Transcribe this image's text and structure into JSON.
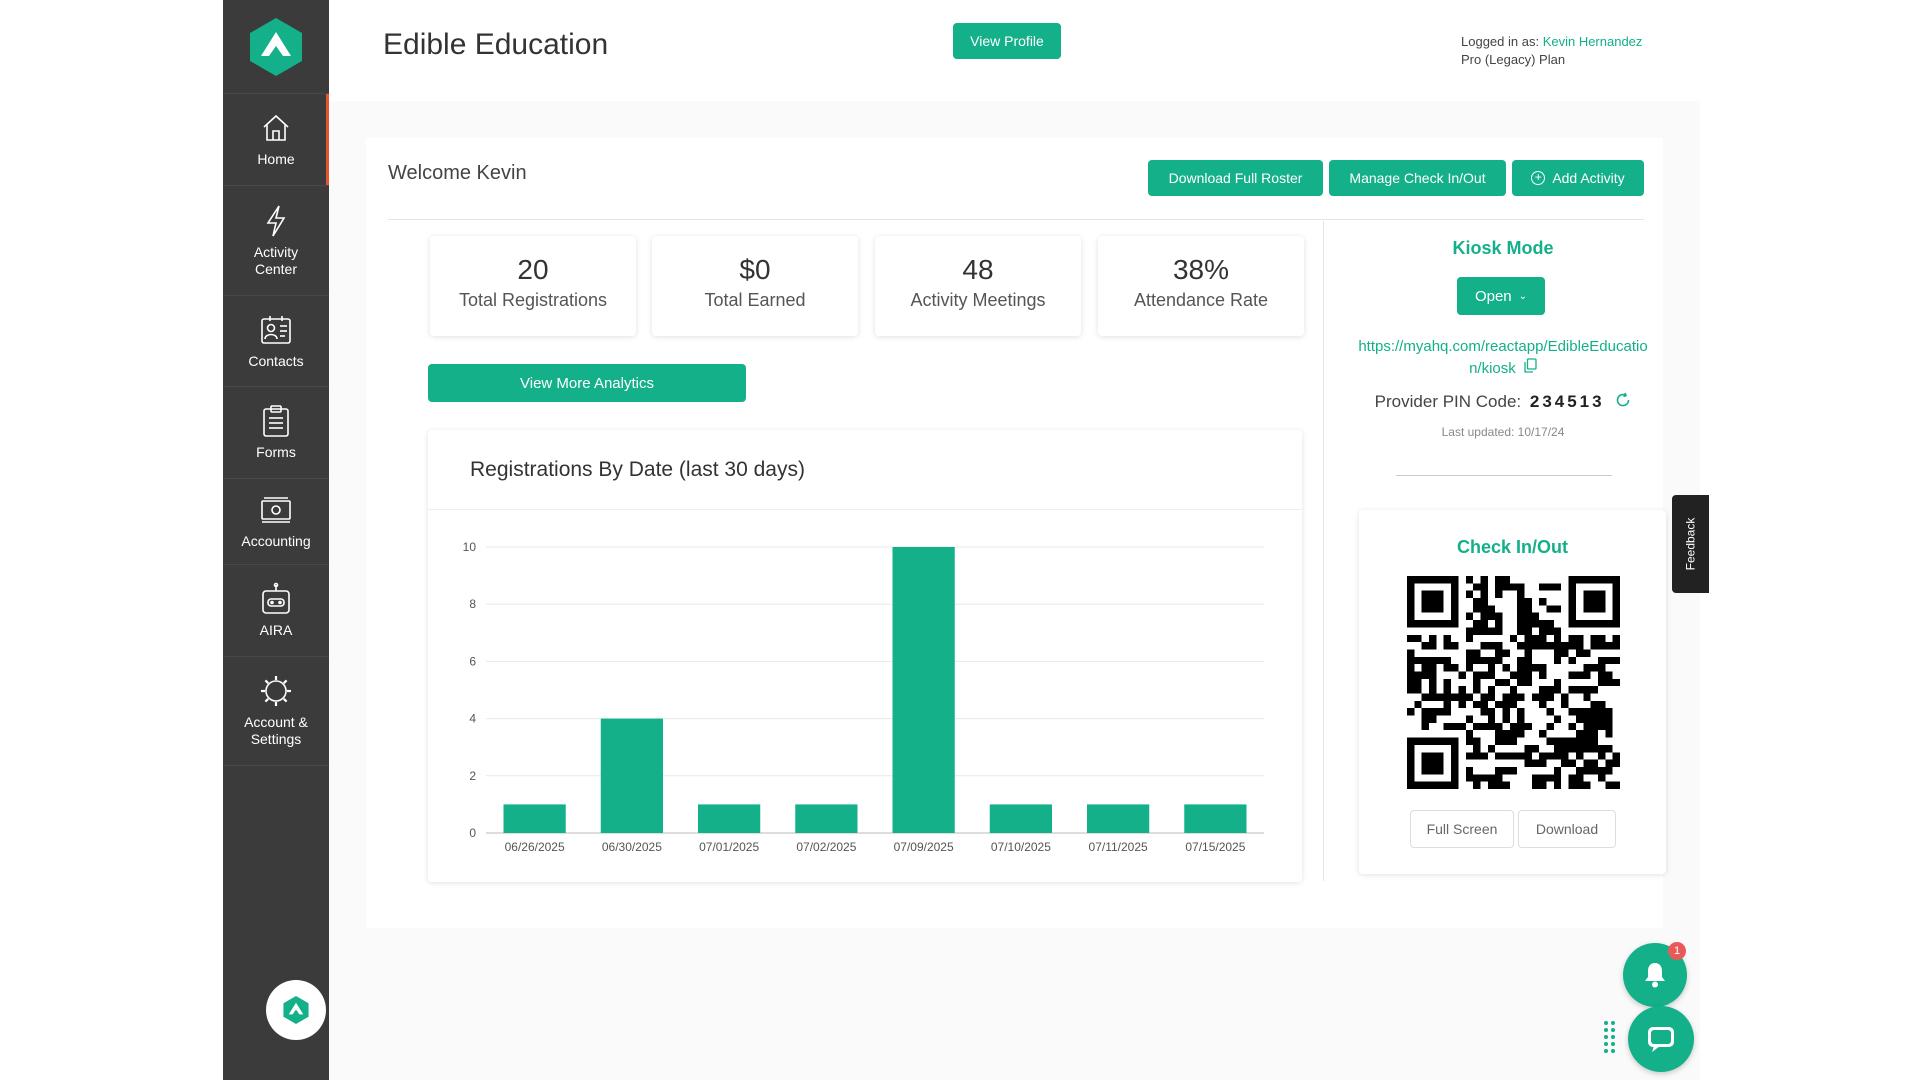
{
  "header": {
    "title": "Edible Education",
    "view_profile_label": "View Profile",
    "logged_in_prefix": "Logged in as: ",
    "user_name": "Kevin Hernandez",
    "plan": "Pro (Legacy) Plan"
  },
  "sidebar": {
    "items": [
      {
        "label": "Home",
        "icon": "home-icon"
      },
      {
        "label": "Activity\nCenter",
        "icon": "lightning-icon"
      },
      {
        "label": "Contacts",
        "icon": "contacts-icon"
      },
      {
        "label": "Forms",
        "icon": "clipboard-icon"
      },
      {
        "label": "Accounting",
        "icon": "money-icon"
      },
      {
        "label": "AIRA",
        "icon": "robot-icon"
      },
      {
        "label": "Account &\nSettings",
        "icon": "gear-icon"
      }
    ]
  },
  "main": {
    "welcome": "Welcome Kevin",
    "buttons": {
      "download_roster": "Download Full Roster",
      "manage_checkin": "Manage Check In/Out",
      "add_activity": "Add Activity"
    },
    "stats": [
      {
        "value": "20",
        "label": "Total Registrations"
      },
      {
        "value": "$0",
        "label": "Total Earned"
      },
      {
        "value": "48",
        "label": "Activity Meetings"
      },
      {
        "value": "38%",
        "label": "Attendance Rate"
      }
    ],
    "analytics_button": "View More Analytics"
  },
  "chart_data": {
    "type": "bar",
    "title": "Registrations By Date (last 30 days)",
    "categories": [
      "06/26/2025",
      "06/30/2025",
      "07/01/2025",
      "07/02/2025",
      "07/09/2025",
      "07/10/2025",
      "07/11/2025",
      "07/15/2025"
    ],
    "values": [
      1,
      4,
      1,
      1,
      10,
      1,
      1,
      1
    ],
    "ylim": [
      0,
      10
    ],
    "yticks": [
      "0",
      "2",
      "4",
      "6",
      "8",
      "10"
    ],
    "grid": true,
    "color": "#13b08a"
  },
  "kiosk": {
    "title": "Kiosk Mode",
    "open_label": "Open",
    "url": "https://myahq.com/reactapp/EdibleEducation/kiosk",
    "pin_label": "Provider PIN Code:",
    "pin_code": "234513",
    "last_updated": "Last updated: 10/17/24"
  },
  "checkin": {
    "title": "Check In/Out",
    "full_screen_label": "Full Screen",
    "download_label": "Download"
  },
  "feedback_label": "Feedback",
  "notification_count": "1",
  "colors": {
    "accent": "#13b08a",
    "sidebar": "#3b3b3b",
    "badge": "#e85a5a"
  }
}
